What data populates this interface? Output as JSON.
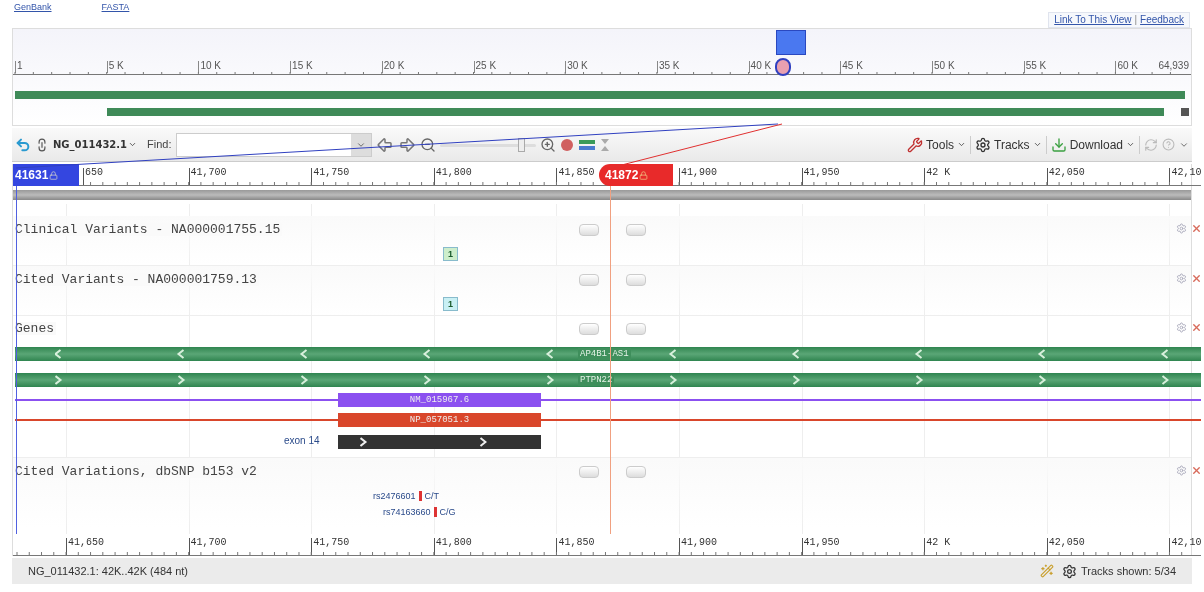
{
  "top_links": [
    "GenBank",
    "FASTA"
  ],
  "header_links": [
    "Link To This View",
    "Feedback"
  ],
  "header_separator": "|",
  "overview": {
    "ticks": [
      "1",
      "5 K",
      "10 K",
      "15 K",
      "20 K",
      "25 K",
      "30 K",
      "35 K",
      "40 K",
      "45 K",
      "50 K",
      "55 K",
      "60 K"
    ],
    "end_label": "64,939"
  },
  "toolbar": {
    "sequence": "NG_011432.1",
    "find_label": "Find:",
    "zoom": {
      "level": 0.88
    },
    "menus": [
      "Tools",
      "Tracks",
      "Download"
    ]
  },
  "ruler": {
    "start_marker": "41631",
    "end_marker": "41872",
    "ticks": [
      "650",
      "41,700",
      "41,750",
      "41,800",
      "41,850",
      "41,900",
      "41,950",
      "42 K",
      "42,050",
      "42,10"
    ]
  },
  "tracks": [
    {
      "kind": "variants",
      "title": "Clinical Variants - NA000001755.15",
      "badge": "1",
      "color": "#cdeecb"
    },
    {
      "kind": "variants",
      "title": "Cited Variants - NA000001759.13",
      "badge": "1",
      "color": "#c9f0f4"
    },
    {
      "kind": "genes",
      "title": "Genes",
      "genes": [
        {
          "label": "AP4B1-AS1",
          "reverse": true
        },
        {
          "label": "PTPN22",
          "reverse": false
        }
      ],
      "transcripts": [
        {
          "label": "NM_015967.6",
          "color": "#8b50f0"
        },
        {
          "label": "NP_057051.3",
          "color": "#d9462b"
        }
      ],
      "exon": {
        "label": "exon 14"
      }
    },
    {
      "kind": "snps",
      "title": "Cited Variations, dbSNP b153 v2",
      "snps": [
        {
          "id": "rs2476601",
          "allele": "C/T"
        },
        {
          "id": "rs74163660",
          "allele": "C/G"
        }
      ]
    }
  ],
  "bottom_ruler": [
    "41,650",
    "41,700",
    "41,750",
    "41,800",
    "41,850",
    "41,900",
    "41,950",
    "42 K",
    "42,050",
    "42,10"
  ],
  "status": {
    "text": "NG_011432.1: 42K..42K (484 nt)",
    "tracks_shown": "Tracks shown: 5/34"
  }
}
